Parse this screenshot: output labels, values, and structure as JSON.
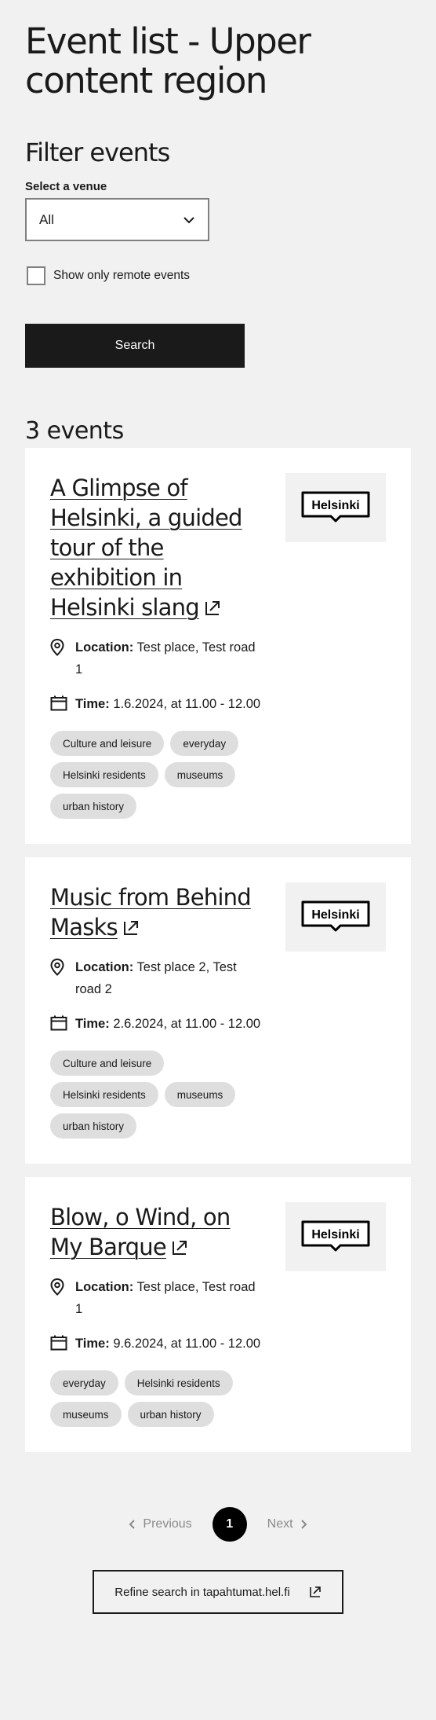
{
  "page_title": "Event list - Upper content region",
  "filter": {
    "heading": "Filter events",
    "venue_label": "Select a venue",
    "venue_selected": "All",
    "remote_label": "Show only remote events",
    "search_label": "Search"
  },
  "results": {
    "count_text": "3 events",
    "location_label": "Location:",
    "time_label": "Time:",
    "logo_text": "Helsinki",
    "events": [
      {
        "title": "A Glimpse of Helsinki, a guided tour of the exhibition in Helsinki slang",
        "location": "Test place, Test road 1",
        "time": "1.6.2024, at 11.00 - 12.00",
        "tags": [
          "Culture and leisure",
          "everyday",
          "Helsinki residents",
          "museums",
          "urban history"
        ]
      },
      {
        "title": "Music from Behind Masks",
        "location": "Test place 2, Test road 2",
        "time": "2.6.2024, at 11.00 - 12.00",
        "tags": [
          "Culture and leisure",
          "Helsinki residents",
          "museums",
          "urban history"
        ]
      },
      {
        "title": "Blow, o Wind, on My Barque",
        "location": "Test place, Test road 1",
        "time": "9.6.2024, at 11.00 - 12.00",
        "tags": [
          "everyday",
          "Helsinki residents",
          "museums",
          "urban history"
        ]
      }
    ]
  },
  "pagination": {
    "previous": "Previous",
    "current": "1",
    "next": "Next"
  },
  "refine_label": "Refine search in tapahtumat.hel.fi"
}
